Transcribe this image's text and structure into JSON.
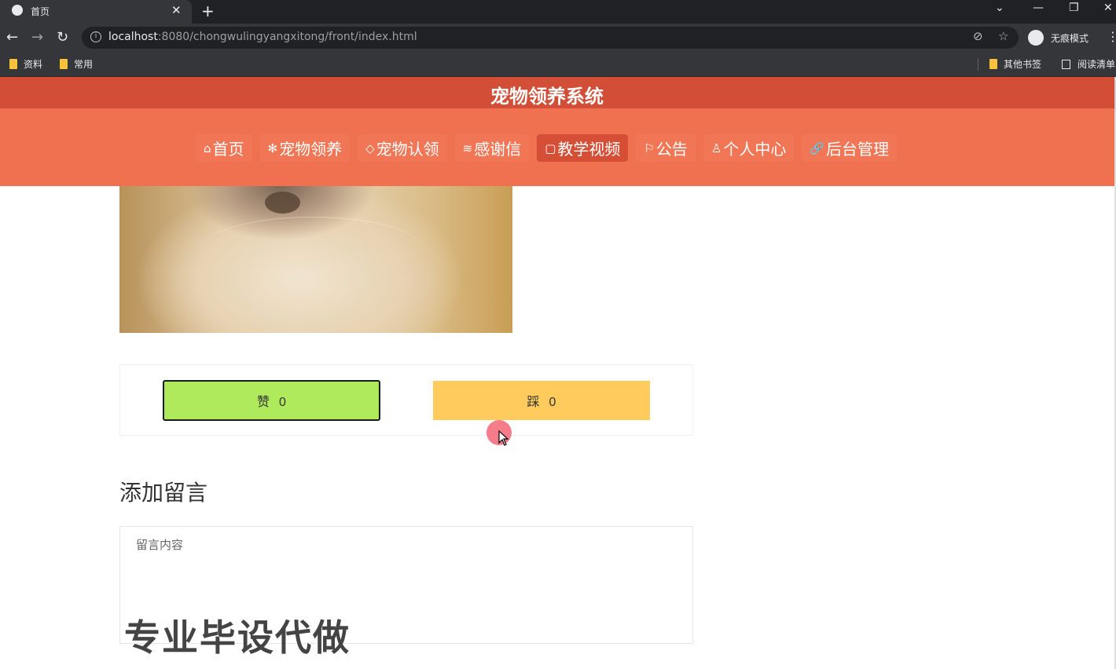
{
  "browser": {
    "tab_title": "首页",
    "tab_close": "✕",
    "new_tab": "+",
    "url_host": "localhost",
    "url_rest": ":8080/chongwulingyangxitong/front/index.html",
    "incognito_label": "无痕模式",
    "bookmarks": [
      "资料",
      "常用"
    ],
    "other_bookmarks": "其他书签",
    "reading_list": "阅读清单"
  },
  "site": {
    "title": "宠物领养系统",
    "nav": [
      {
        "icon": "⌂",
        "label": "首页"
      },
      {
        "icon": "✻",
        "label": "宠物领养"
      },
      {
        "icon": "◇",
        "label": "宠物认领"
      },
      {
        "icon": "≋",
        "label": "感谢信"
      },
      {
        "icon": "▢",
        "label": "教学视频"
      },
      {
        "icon": "⚐",
        "label": "公告"
      },
      {
        "icon": "♙",
        "label": "个人中心"
      },
      {
        "icon": "🔗",
        "label": "后台管理"
      }
    ],
    "active_nav": "教学视频"
  },
  "votes": {
    "like_label": "赞",
    "like_count": "0",
    "dislike_label": "踩",
    "dislike_count": "0"
  },
  "comment": {
    "section_title": "添加留言",
    "placeholder": "留言内容"
  },
  "watermark": "专业毕设代做",
  "colors": {
    "title_bar": "#d34e36",
    "nav_bar": "#f07150",
    "like": "#aeea5c",
    "dislike": "#fecb5c"
  }
}
